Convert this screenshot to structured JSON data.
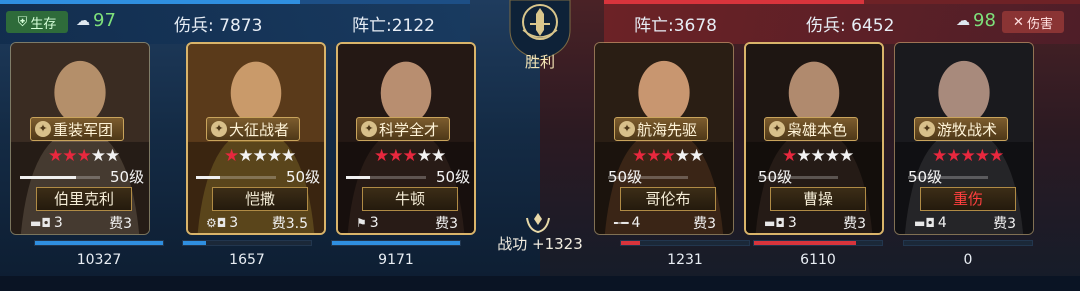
{
  "left_side": {
    "status_badge": "生存",
    "morale": "97",
    "wounded": "伤兵: 7873",
    "dead": "阵亡:2122"
  },
  "right_side": {
    "status_badge": "伤害",
    "morale": "98",
    "wounded": "伤兵: 6452",
    "dead": "阵亡:3678"
  },
  "center": {
    "result": "胜利",
    "merit": "战功 +1323"
  },
  "colors": {
    "left_accent": "#2f8fe0",
    "right_accent": "#d8343c",
    "star_on": "#e8283e",
    "gold": "#d9b46a"
  },
  "heroes": [
    {
      "side": "left",
      "title": "重装军团",
      "stars": 3,
      "level": "50级",
      "name": "伯里克利",
      "unit_icon": "tank-icon",
      "unit_count": "3",
      "cost": "费3",
      "troops": "10327",
      "troop_fill": 1.0,
      "level_fill": 0.7
    },
    {
      "side": "left",
      "title": "大征战者",
      "stars": 1,
      "level": "50级",
      "name": "恺撒",
      "unit_icon": "chariot-icon",
      "unit_count": "3",
      "cost": "费3.5",
      "troops": "1657",
      "troop_fill": 0.18,
      "level_fill": 0.3
    },
    {
      "side": "left",
      "title": "科学全才",
      "stars": 3,
      "level": "50级",
      "name": "牛顿",
      "unit_icon": "flag-icon",
      "unit_count": "3",
      "cost": "费3",
      "troops": "9171",
      "troop_fill": 1.0,
      "level_fill": 0.3
    },
    {
      "side": "right",
      "title": "航海先驱",
      "stars": 3,
      "level": "50级",
      "name": "哥伦布",
      "unit_icon": "rifle-icon",
      "unit_count": "4",
      "cost": "费3",
      "troops": "1231",
      "troop_fill": 0.15,
      "level_fill": 0.0
    },
    {
      "side": "right",
      "title": "枭雄本色",
      "stars": 1,
      "level": "50级",
      "name": "曹操",
      "unit_icon": "tank-icon",
      "unit_count": "3",
      "cost": "费3",
      "troops": "6110",
      "troop_fill": 0.8,
      "level_fill": 0.0
    },
    {
      "side": "right",
      "title": "游牧战术",
      "stars": 5,
      "level": "50级",
      "name": "重伤",
      "unit_icon": "tank-icon",
      "unit_count": "4",
      "cost": "费3",
      "troops": "0",
      "troop_fill": 0.0,
      "level_fill": 0.0
    }
  ]
}
